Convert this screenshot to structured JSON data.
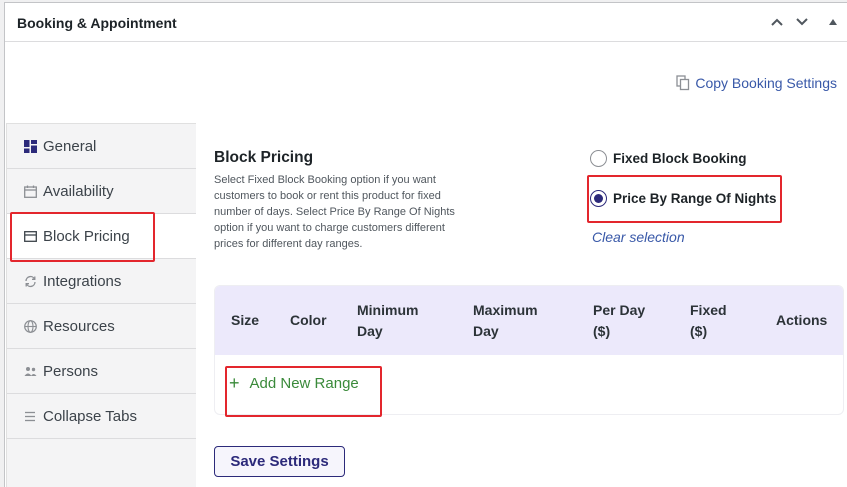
{
  "panel": {
    "title": "Booking & Appointment"
  },
  "copy_settings_label": "Copy Booking Settings",
  "tabs": [
    {
      "label": "General",
      "icon": "dashboard-icon"
    },
    {
      "label": "Availability",
      "icon": "calendar-icon"
    },
    {
      "label": "Block Pricing",
      "icon": "card-icon"
    },
    {
      "label": "Integrations",
      "icon": "sync-icon"
    },
    {
      "label": "Resources",
      "icon": "globe-icon"
    },
    {
      "label": "Persons",
      "icon": "people-icon"
    },
    {
      "label": "Collapse Tabs",
      "icon": "menu-icon"
    }
  ],
  "active_tab": "Block Pricing",
  "section": {
    "title": "Block Pricing",
    "description": "Select Fixed Block Booking option if you want customers to book or rent this product for fixed number of days. Select Price By Range Of Nights option if you want to charge customers different prices for different day ranges."
  },
  "options": {
    "fixed_block": "Fixed Block Booking",
    "range_nights": "Price By Range Of Nights",
    "selected": "Price By Range Of Nights",
    "clear_label": "Clear selection"
  },
  "table": {
    "columns": [
      "Size",
      "Color",
      "Minimum\nDay",
      "Maximum\nDay",
      "Per Day\n($)",
      "Fixed\n($)",
      "Actions"
    ],
    "col_size": "Size",
    "col_color": "Color",
    "col_min_1": "Minimum",
    "col_min_2": "Day",
    "col_max_1": "Maximum",
    "col_max_2": "Day",
    "col_perday_1": "Per Day",
    "col_perday_2": "($)",
    "col_fixed_1": "Fixed",
    "col_fixed_2": "($)",
    "col_actions": "Actions",
    "add_label": "Add New Range"
  },
  "save_label": "Save Settings",
  "colors": {
    "accent": "#2c2a7a",
    "link": "#3858a8",
    "highlight": "#e3262d",
    "add_green": "#3a8a3a",
    "table_header": "#ece9fb"
  }
}
